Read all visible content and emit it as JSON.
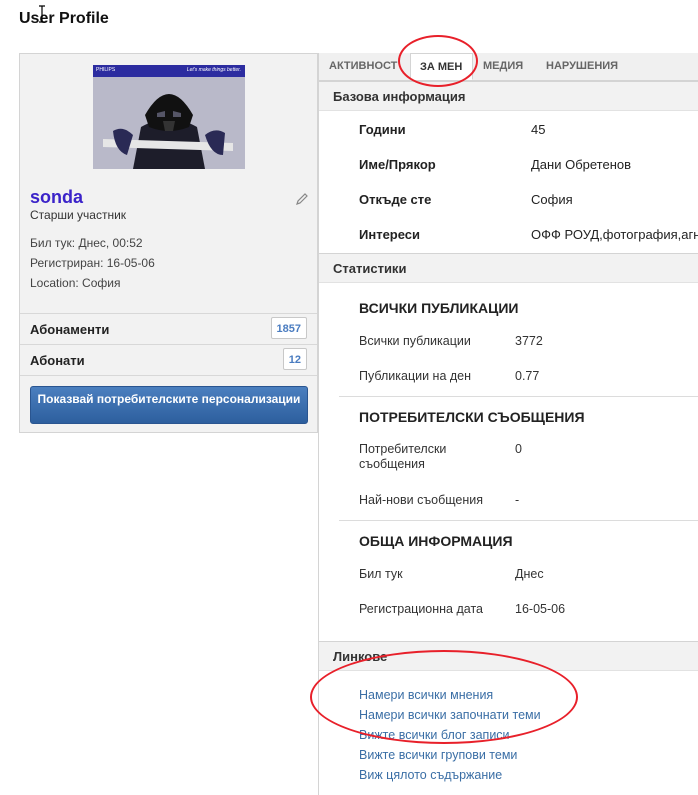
{
  "page": {
    "title": "User Profile"
  },
  "profile": {
    "avatar": {
      "brand": "PHILIPS",
      "tagline": "Let's make things better."
    },
    "username": "sonda",
    "rank": "Старши участник",
    "last_seen": "Бил тук: Днес, 00:52",
    "registered": "Регистриран: 16-05-06",
    "location": "Location: София",
    "subscriptions": {
      "label": "Абонаменти",
      "count": "1857"
    },
    "subscribers": {
      "label": "Абонати",
      "count": "12"
    },
    "customize_button": "Показвай потребителските персонализации"
  },
  "tabs": [
    {
      "label": "АКТИВНОСТ",
      "active": false
    },
    {
      "label": "ЗА МЕН",
      "active": true
    },
    {
      "label": "МЕДИЯ",
      "active": false
    },
    {
      "label": "НАРУШЕНИЯ",
      "active": false
    }
  ],
  "basic_info": {
    "title": "Базова информация",
    "rows": [
      {
        "label": "Години",
        "value": "45"
      },
      {
        "label": "Име/Прякор",
        "value": "Дани Обретенов"
      },
      {
        "label": "Откъде сте",
        "value": "София"
      },
      {
        "label": "Интереси",
        "value": "ОФФ РОУД,фотография,агн"
      }
    ]
  },
  "statistics": {
    "title": "Статистики",
    "all_posts": {
      "title": "ВСИЧКИ ПУБЛИКАЦИИ",
      "rows": [
        {
          "label": "Всички публикации",
          "value": "3772"
        },
        {
          "label": "Публикации на ден",
          "value": "0.77"
        }
      ]
    },
    "user_messages": {
      "title": "ПОТРЕБИТЕЛСКИ СЪОБЩЕНИЯ",
      "rows": [
        {
          "label": "Потребителски съобщения",
          "value": "0"
        },
        {
          "label": "Най-нови съобщения",
          "value": "-"
        }
      ]
    },
    "general": {
      "title": "ОБЩА ИНФОРМАЦИЯ",
      "rows": [
        {
          "label": "Бил тук",
          "value": "Днес"
        },
        {
          "label": "Регистрационна дата",
          "value": "16-05-06"
        }
      ]
    }
  },
  "links": {
    "title": "Линкове",
    "items": [
      "Намери всички мнения",
      "Намери всички започнати теми",
      "Вижте всички блог записи",
      "Вижте всички групови теми",
      "Виж цялото съдържание"
    ]
  },
  "colors": {
    "annotation": "#e8202a",
    "link": "#3a6ea5",
    "username": "#3b23c9",
    "button": "#2d5f9e"
  }
}
